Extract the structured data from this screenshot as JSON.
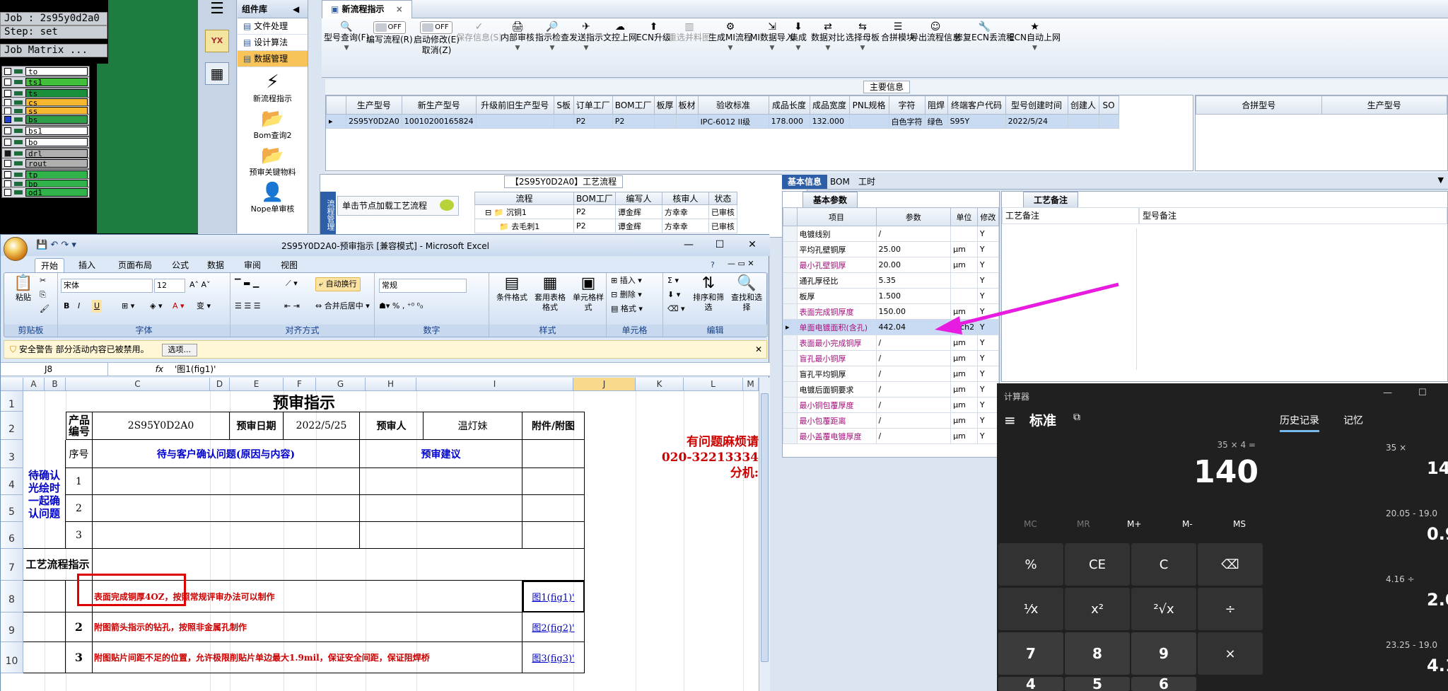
{
  "job_matrix": {
    "title": "Job : 2s95y0d2a0",
    "step": "Step: set",
    "menu": "Job Matrix ...",
    "layers": [
      "to",
      "ts1",
      "ts",
      "cs",
      "ss",
      "bs",
      "bs1",
      "bo",
      "drl",
      "rout",
      "tp",
      "bp",
      "od1"
    ]
  },
  "component_panel": {
    "title": "组件库",
    "items": [
      "文件处理",
      "设计算法",
      "数据管理"
    ],
    "tools": [
      "新流程指示",
      "Bom查询2",
      "预审关键物料",
      "Nope单审核"
    ]
  },
  "side_logo": "YX",
  "tab": {
    "label": "新流程指示",
    "close": "×"
  },
  "toolbar": {
    "buttons": [
      "型号查询(F)",
      "编写流程(R)",
      "启动修改(E)",
      "取消(Z)",
      "保存信息(S)",
      "内部审核",
      "指示检查",
      "发送指示",
      "文控上网",
      "ECN升级",
      "重选并料图",
      "生成MI流程",
      "MI数据导入",
      "集成",
      "数据对比",
      "选择母板",
      "合拼模块",
      "导出流程信息",
      "修复ECN丢流程",
      "ECN自动上网"
    ],
    "toggle_off": "OFF"
  },
  "main_info": {
    "title": "主要信息",
    "columns": [
      "生产型号",
      "新生产型号",
      "升级前旧生产型号",
      "S板",
      "订单工厂",
      "BOM工厂",
      "板厚",
      "板材",
      "验收标准",
      "成品长度",
      "成品宽度",
      "PNL规格",
      "字符",
      "阻焊",
      "终端客户代码",
      "型号创建时间",
      "创建人",
      "SO"
    ],
    "row": [
      "2S95Y0D2A0",
      "10010200165824",
      "",
      "",
      "P2",
      "P2",
      "",
      "",
      "IPC-6012 II级",
      "178.000",
      "132.000",
      "",
      "白色字符",
      "绿色",
      "S95Y",
      "2022/5/24",
      "",
      ""
    ],
    "side_columns": [
      "合拼型号",
      "生产型号"
    ]
  },
  "process": {
    "title": "【2S95Y0D2A0】工艺流程",
    "load_hint": "单击节点加载工艺流程",
    "side_label": "流程管理",
    "columns": [
      "流程",
      "BOM工厂",
      "编写人",
      "核审人",
      "状态"
    ],
    "rows": [
      {
        "name": "沉铜1",
        "bom": "P2",
        "writer": "谭金辉",
        "checker": "方幸幸",
        "status": "已审核"
      },
      {
        "name": "去毛刺1",
        "bom": "P2",
        "writer": "谭金辉",
        "checker": "方幸幸",
        "status": "已审核"
      }
    ]
  },
  "info_tabs": [
    "基本信息",
    "BOM",
    "工时"
  ],
  "params": {
    "tab": "基本参数",
    "columns": [
      "项目",
      "参数",
      "单位",
      "修改"
    ],
    "rows": [
      {
        "item": "电镀线别",
        "val": "/",
        "unit": "",
        "mod": "Y",
        "mag": false
      },
      {
        "item": "平均孔壁铜厚",
        "val": "25.00",
        "unit": "μm",
        "mod": "Y",
        "mag": false
      },
      {
        "item": "最小孔壁铜厚",
        "val": "20.00",
        "unit": "μm",
        "mod": "Y",
        "mag": true
      },
      {
        "item": "通孔厚径比",
        "val": "5.35",
        "unit": "",
        "mod": "Y",
        "mag": false
      },
      {
        "item": "板厚",
        "val": "1.500",
        "unit": "",
        "mod": "Y",
        "mag": false
      },
      {
        "item": "表面完成铜厚度",
        "val": "150.00",
        "unit": "μm",
        "mod": "Y",
        "mag": true
      },
      {
        "item": "单面电镀面积(含孔)",
        "val": "442.04",
        "unit": "inch2",
        "mod": "Y",
        "mag": true
      },
      {
        "item": "表面最小完成铜厚",
        "val": "/",
        "unit": "μm",
        "mod": "Y",
        "mag": true
      },
      {
        "item": "盲孔最小铜厚",
        "val": "/",
        "unit": "μm",
        "mod": "Y",
        "mag": true
      },
      {
        "item": "盲孔平均铜厚",
        "val": "/",
        "unit": "μm",
        "mod": "Y",
        "mag": false
      },
      {
        "item": "电镀后面铜要求",
        "val": "/",
        "unit": "μm",
        "mod": "Y",
        "mag": false
      },
      {
        "item": "最小铜包覆厚度",
        "val": "/",
        "unit": "μm",
        "mod": "Y",
        "mag": true
      },
      {
        "item": "最小包覆距离",
        "val": "/",
        "unit": "μm",
        "mod": "Y",
        "mag": true
      },
      {
        "item": "最小盖覆电镀厚度",
        "val": "/",
        "unit": "μm",
        "mod": "Y",
        "mag": true
      }
    ]
  },
  "remarks": {
    "tab": "工艺备注",
    "col1": "工艺备注",
    "col2": "型号备注"
  },
  "excel": {
    "title": "2S95Y0D2A0-预审指示 [兼容模式] - Microsoft Excel",
    "tabs": [
      "开始",
      "插入",
      "页面布局",
      "公式",
      "数据",
      "审阅",
      "视图"
    ],
    "font": "宋体",
    "font_size": "12",
    "number_format": "常规",
    "wrap": "自动换行",
    "merge": "合并后居中",
    "groups": [
      "剪贴板",
      "字体",
      "对齐方式",
      "数字",
      "样式",
      "单元格",
      "编辑"
    ],
    "paste": "粘贴",
    "style_btns": [
      "条件格式",
      "套用表格格式",
      "单元格样式"
    ],
    "cell_btns": [
      "插入",
      "删除",
      "格式"
    ],
    "edit_btns": [
      "排序和筛选",
      "查找和选择"
    ],
    "warning": "安全警告  部分活动内容已被禁用。",
    "warning_opt": "选项...",
    "namebox": "J8",
    "formula": "'图1(fig1)'",
    "fx": "fx",
    "columns": [
      "A",
      "B",
      "C",
      "D",
      "E",
      "F",
      "G",
      "H",
      "I",
      "J",
      "K",
      "L",
      "M"
    ],
    "rows": [
      "1",
      "2",
      "3",
      "4",
      "5",
      "6",
      "7",
      "8",
      "9",
      "10"
    ],
    "sheet": {
      "title": "预审指示",
      "product_no_label": "产品编号",
      "product_no": "2S95Y0D2A0",
      "date_label": "预审日期",
      "date": "2022/5/25",
      "reviewer_label": "预审人",
      "reviewer": "温灯妹",
      "attach_label": "附件/附图",
      "confirm_label": "待确认光绘时一起确认问题",
      "seq_label": "序号",
      "issue_label": "待与客户确认问题(原因与内容)",
      "advice_label": "预审建议",
      "process_label": "工艺流程指示",
      "contact": "有问题麻烦请\n020-32213334\n分机:",
      "n1": "1",
      "n2": "2",
      "n3": "3",
      "instructions": [
        {
          "no": "",
          "text": "表面完成铜厚4OZ，按照常规评审办法可以制作",
          "link": "图1(fig1)'"
        },
        {
          "no": "2",
          "text": "附图箭头指示的钻孔，按照非金属孔制作",
          "link": "图2(fig2)'"
        },
        {
          "no": "3",
          "text": "附图贴片间距不足的位置，允许极限削贴片单边最大1.9mil，保证安全间距，保证阻焊桥",
          "link": "图3(fig3)'"
        }
      ]
    }
  },
  "calculator": {
    "title": "计算器",
    "mode": "标准",
    "expr": "35 × 4 =",
    "display": "140",
    "history_tab": "历史记录",
    "memory_tab": "记忆",
    "mem_keys": [
      "MC",
      "MR",
      "M+",
      "M-",
      "MS"
    ],
    "keys": [
      "%",
      "CE",
      "C",
      "⌫",
      "¹⁄x",
      "x²",
      "²√x",
      "÷",
      "7",
      "8",
      "9",
      "×",
      "4",
      "5",
      "6"
    ],
    "history": [
      {
        "expr": "35 ×",
        "res": "14"
      },
      {
        "expr": "20.05 - 19.0",
        "res": "0.9"
      },
      {
        "expr": "4.16 ÷",
        "res": "2.0"
      },
      {
        "expr": "23.25 - 19.0",
        "res": "4.1"
      }
    ]
  },
  "colors": {
    "arrow": "#e81ce0",
    "excel_red": "#cc0000",
    "excel_blue": "#0000cc",
    "magenta": "#a3107c",
    "highlight_box": "#dd0000"
  }
}
